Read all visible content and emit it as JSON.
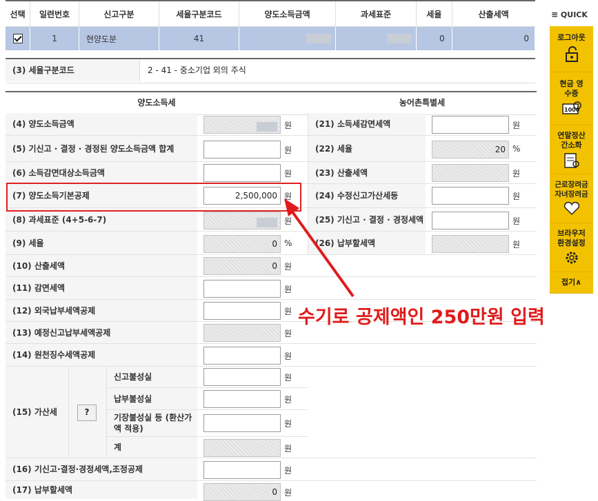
{
  "top_table": {
    "headers": [
      "선택",
      "일련번호",
      "신고구분",
      "세율구분코드",
      "양도소득금액",
      "과세표준",
      "세율",
      "산출세액"
    ],
    "row": {
      "serial": "1",
      "type": "현양도분",
      "rate_code": "41",
      "rate": "0",
      "tax": "0"
    }
  },
  "rate_code_row": {
    "label": "(3) 세율구분코드",
    "value": "2 - 41 - 중소기업 외의 주식"
  },
  "section_left": "양도소득세",
  "section_right": "농어촌특별세",
  "unit_won": "원",
  "unit_pct": "%",
  "left_rows": {
    "r4": "(4) 양도소득금액",
    "r5": "(5) 기신고 · 결정 · 경정된 양도소득금액 합계",
    "r6": "(6) 소득감면대상소득금액",
    "r7": "(7) 양도소득기본공제",
    "r8": "(8) 과세표준 (4+5-6-7)",
    "r9": "(9) 세율",
    "r10": "(10) 산출세액",
    "r11": "(11) 감면세액",
    "r12": "(12) 외국납부세액공제",
    "r13": "(13) 예정신고납부세액공제",
    "r14": "(14) 원천징수세액공제",
    "r15": "(15) 가산세",
    "r15a": "신고불성실",
    "r15b": "납부불성실",
    "r15c": "기장불성실 등 (환산가액 적용)",
    "r15d": "계",
    "r16": "(16) 기신고·결정·경정세액,조정공제",
    "r17": "(17) 납부할세액"
  },
  "right_rows": {
    "r21": "(21) 소득세감면세액",
    "r22": "(22) 세율",
    "r23": "(23) 산출세액",
    "r24": "(24) 수정신고가산세등",
    "r25": "(25) 기신고 · 결정 · 경정세액",
    "r26": "(26) 납부할세액"
  },
  "values": {
    "r7": "2,500,000",
    "r9": "0",
    "r10": "0",
    "r17": "0",
    "r22": "20"
  },
  "help_button": "?",
  "annotation": "수기로 공제액인 250만원 입력",
  "quick_menu": {
    "title": "QUICK",
    "items": [
      "로그아웃",
      "현금 영수증",
      "연말정산 간소화",
      "근로장려금 자녀장려금",
      "브라우저 환경설정"
    ],
    "collapse": "접기∧"
  },
  "colors": {
    "accent": "#f2c200",
    "annotation": "#e01b1b",
    "selected_row": "#b7c6e3"
  }
}
